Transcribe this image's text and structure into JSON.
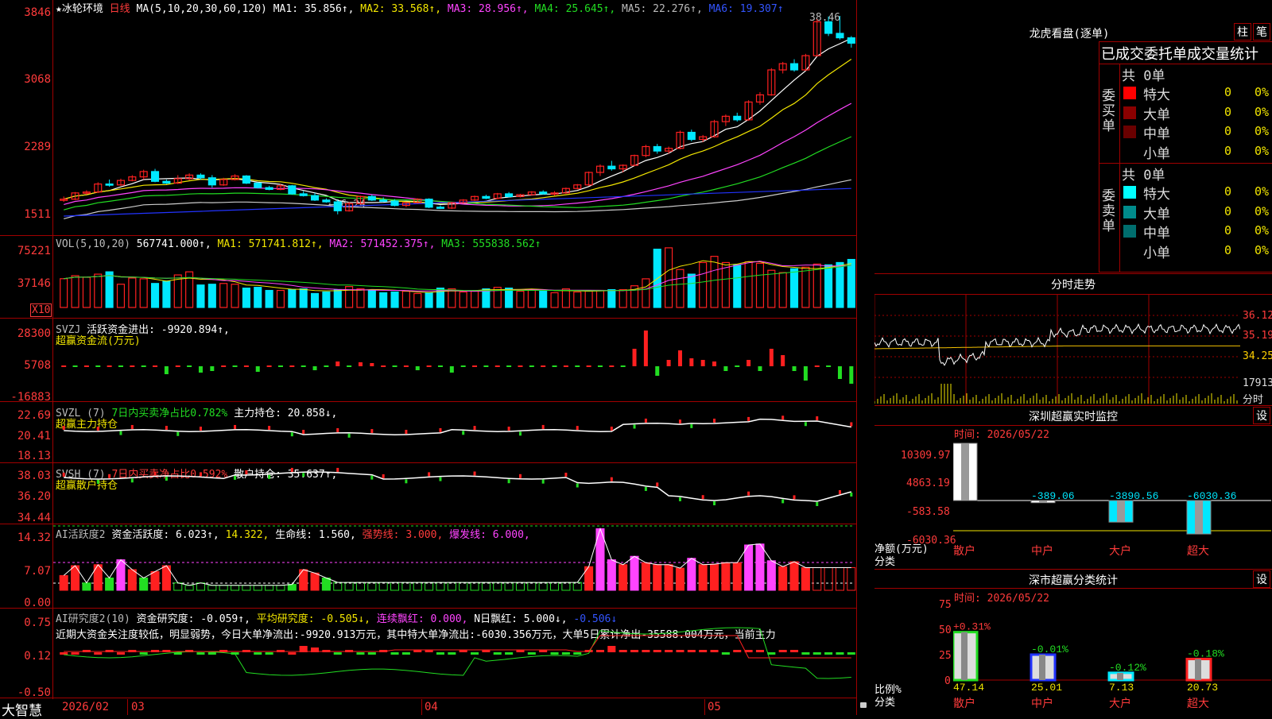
{
  "colors": {
    "grid": "#a00000",
    "up": "#ff2020",
    "down": "#00e8ff",
    "ma1": "#ffffff",
    "ma2": "#f2e600",
    "ma3": "#ff44ff",
    "ma4": "#22dd22",
    "ma5": "#cccccc",
    "ma6": "#2233ff"
  },
  "price_pane": {
    "title_star": "★",
    "stock_name": "冰轮环境",
    "period": "日线",
    "ma_spec": "MA(5,10,20,30,60,120)",
    "ma1": "MA1: 35.856↑,",
    "ma2": "MA2: 33.568↑,",
    "ma3": "MA3: 28.956↑,",
    "ma4": "MA4: 25.645↑,",
    "ma5": "MA5: 22.276↑,",
    "ma6": "MA6: 19.307↑",
    "axis": [
      "3846",
      "3068",
      "2289",
      "1511"
    ],
    "high_mark": "38.46",
    "low_mark": "←16.24"
  },
  "vol_pane": {
    "label": "VOL(5,10,20)",
    "vol": "567741.000↑,",
    "ma1": "MA1: 571741.812↑,",
    "ma2": "MA2: 571452.375↑,",
    "ma3": "MA3: 555838.562↑",
    "axis": [
      "75221",
      "37146"
    ],
    "unit": "X10"
  },
  "svzj_pane": {
    "label": "SVZJ",
    "text": "活跃资金进出: -9920.894↑,",
    "subtitle": "超赢资金流(万元)",
    "axis": [
      "28300",
      "5708",
      "-16883"
    ]
  },
  "svzl_pane": {
    "label": "SVZL (7)",
    "text1": "7日内买卖净占比0.782%",
    "text2": "主力持仓: 20.858↓,",
    "subtitle": "超赢主力持仓",
    "axis": [
      "22.69",
      "20.41",
      "18.13"
    ]
  },
  "svsh_pane": {
    "label": "SVSH (7)",
    "text1": "7日内买卖净占比0.592%",
    "text2": "散户持仓: 35.637↑,",
    "subtitle": "超赢散户持仓",
    "axis": [
      "38.03",
      "36.20",
      "34.44"
    ]
  },
  "ai_active_pane": {
    "label": "AI活跃度2",
    "t1": "资金活跃度: 6.023↑,",
    "t2": "14.322,",
    "t3": "生命线: 1.560,",
    "t4": "强势线: 3.000,",
    "t5": "爆发线: 6.000,",
    "axis": [
      "14.32",
      "7.07",
      "0.00"
    ]
  },
  "ai_research_pane": {
    "label": "AI研究度2(10)",
    "t1": "资金研究度: -0.059↑,",
    "t2": "平均研究度: -0.505↓,",
    "t3": "连续飘红: 0.000,",
    "t4": "N日飘红: 5.000↓,",
    "t5": "-0.506↓",
    "comment": "近期大资金关注度较低，明显弱势，今日大单净流出:-9920.913万元，其中特大单净流出:-6030.356万元，大单5日累计净出-35588.004万元，当前主力",
    "axis": [
      "0.75",
      "0.12",
      "-0.50"
    ]
  },
  "bottom_bar": {
    "brand": "大智慧",
    "dates": [
      "2026/02",
      "03",
      "04",
      "05"
    ]
  },
  "lhb": {
    "title": "龙虎看盘(逐单)",
    "btn1": "柱",
    "btn2": "笔",
    "header": "已成交委托单成交量统计",
    "buy_label": "委买单",
    "sell_label": "委卖单",
    "buy_total": "共 0单",
    "sell_total": "共 0单",
    "buy_rows": [
      {
        "name": "特大",
        "count": "0",
        "pct": "0%",
        "color": "#ff0000"
      },
      {
        "name": "大单",
        "count": "0",
        "pct": "0%",
        "color": "#8b0000"
      },
      {
        "name": "中单",
        "count": "0",
        "pct": "0%",
        "color": "#6a0000"
      },
      {
        "name": "小单",
        "count": "0",
        "pct": "0%",
        "color": "#000000"
      }
    ],
    "sell_rows": [
      {
        "name": "特大",
        "count": "0",
        "pct": "0%",
        "color": "#00ffff"
      },
      {
        "name": "大单",
        "count": "0",
        "pct": "0%",
        "color": "#008b8b"
      },
      {
        "name": "中单",
        "count": "0",
        "pct": "0%",
        "color": "#006e6e"
      },
      {
        "name": "小单",
        "count": "0",
        "pct": "0%",
        "color": "#000000"
      }
    ]
  },
  "intraday": {
    "title": "分时走势",
    "right_axis": [
      "36.12",
      "35.19",
      "34.25",
      "17913"
    ],
    "unit_label": "分时"
  },
  "sz_monitor": {
    "title": "深圳超赢实时监控",
    "btn": "设",
    "time": "时间: 2026/05/22",
    "axis": [
      "10309.97",
      "4863.19",
      "-583.58",
      "-6030.36"
    ],
    "ylabel1": "净额(万元)",
    "ylabel2": "分类",
    "bars": [
      {
        "cat": "散户",
        "value": 10309.97,
        "label": "10309.97",
        "color": "#ffffff"
      },
      {
        "cat": "中户",
        "value": -389.06,
        "label": "-389.06",
        "color": "#ffffff"
      },
      {
        "cat": "大户",
        "value": -3890.56,
        "label": "-3890.56",
        "color": "#00e8ff"
      },
      {
        "cat": "超大",
        "value": -6030.36,
        "label": "-6030.36",
        "color": "#00e8ff"
      }
    ]
  },
  "sz_class": {
    "title": "深市超赢分类统计",
    "btn": "设",
    "time": "时间: 2026/05/22",
    "axis": [
      "75",
      "50",
      "25",
      "0"
    ],
    "ylabel1": "比例%",
    "ylabel2": "分类",
    "bars": [
      {
        "cat": "散户",
        "value": 47.14,
        "label": "47.14",
        "delta": "+0.31%",
        "color": "#ffffff",
        "edge": "#22dd22"
      },
      {
        "cat": "中户",
        "value": 25.01,
        "label": "25.01",
        "delta": "-0.01%",
        "color": "#ffffff",
        "edge": "#2233ff"
      },
      {
        "cat": "大户",
        "value": 7.13,
        "label": "7.13",
        "delta": "-0.12%",
        "color": "#ffffff",
        "edge": "#00e8ff"
      },
      {
        "cat": "超大",
        "value": 20.73,
        "label": "20.73",
        "delta": "-0.18%",
        "color": "#ffffff",
        "edge": "#ff2020"
      }
    ]
  },
  "chart_data": {
    "type": "candlestick",
    "candles_ohlc_approx": [
      [
        17.8,
        18.2,
        17.6,
        17.9
      ],
      [
        17.9,
        18.7,
        17.8,
        18.6
      ],
      [
        18.6,
        18.9,
        18.4,
        18.7
      ],
      [
        18.7,
        19.8,
        18.6,
        19.6
      ],
      [
        19.6,
        20.1,
        19.3,
        19.5
      ],
      [
        19.5,
        20.2,
        19.4,
        20.0
      ],
      [
        20.0,
        20.6,
        19.9,
        20.4
      ],
      [
        20.4,
        21.2,
        20.1,
        21.0
      ],
      [
        21.0,
        21.3,
        19.8,
        19.9
      ],
      [
        19.9,
        20.1,
        19.6,
        19.7
      ],
      [
        19.7,
        20.6,
        19.6,
        20.2
      ],
      [
        20.2,
        20.8,
        20.0,
        20.6
      ],
      [
        20.6,
        20.8,
        20.1,
        20.3
      ],
      [
        20.3,
        20.6,
        19.2,
        19.5
      ],
      [
        19.5,
        20.3,
        19.4,
        20.1
      ],
      [
        20.1,
        20.7,
        20.0,
        20.5
      ],
      [
        20.5,
        20.6,
        19.6,
        19.7
      ],
      [
        19.7,
        19.8,
        19.1,
        19.2
      ],
      [
        19.2,
        19.4,
        18.9,
        19.0
      ],
      [
        19.0,
        19.6,
        18.9,
        19.4
      ],
      [
        19.4,
        19.5,
        18.4,
        18.5
      ],
      [
        18.5,
        18.8,
        18.2,
        18.3
      ],
      [
        18.3,
        18.6,
        17.7,
        17.8
      ],
      [
        17.8,
        18.0,
        17.5,
        17.6
      ],
      [
        17.6,
        17.8,
        16.2,
        16.6
      ],
      [
        16.6,
        17.6,
        16.5,
        17.4
      ],
      [
        17.4,
        18.3,
        17.3,
        18.2
      ],
      [
        18.2,
        18.4,
        17.7,
        17.8
      ],
      [
        17.8,
        18.1,
        17.6,
        17.7
      ],
      [
        17.7,
        17.9,
        17.1,
        17.2
      ],
      [
        17.2,
        17.6,
        17.0,
        17.5
      ],
      [
        17.5,
        18.0,
        17.4,
        17.9
      ],
      [
        17.9,
        18.0,
        16.9,
        17.0
      ],
      [
        17.0,
        17.2,
        16.8,
        16.9
      ],
      [
        16.9,
        17.6,
        16.8,
        17.5
      ],
      [
        17.5,
        17.9,
        17.4,
        17.8
      ],
      [
        17.8,
        18.3,
        17.7,
        18.2
      ],
      [
        18.2,
        18.4,
        17.9,
        18.0
      ],
      [
        18.0,
        18.6,
        17.9,
        18.5
      ],
      [
        18.5,
        18.7,
        18.1,
        18.2
      ],
      [
        18.2,
        18.5,
        18.1,
        18.4
      ],
      [
        18.4,
        18.8,
        18.3,
        18.7
      ],
      [
        18.7,
        18.9,
        18.4,
        18.5
      ],
      [
        18.5,
        18.8,
        18.3,
        18.6
      ],
      [
        18.6,
        19.2,
        18.5,
        19.1
      ],
      [
        19.1,
        19.6,
        19.0,
        19.5
      ],
      [
        19.5,
        21.0,
        19.4,
        20.9
      ],
      [
        20.9,
        21.8,
        20.5,
        21.6
      ],
      [
        21.6,
        22.2,
        21.1,
        21.3
      ],
      [
        21.3,
        21.8,
        20.9,
        21.7
      ],
      [
        21.7,
        22.9,
        21.6,
        22.8
      ],
      [
        22.8,
        24.0,
        22.6,
        23.8
      ],
      [
        23.8,
        24.1,
        23.0,
        23.3
      ],
      [
        23.3,
        23.8,
        23.0,
        23.6
      ],
      [
        23.6,
        25.6,
        23.5,
        25.4
      ],
      [
        25.4,
        25.7,
        24.4,
        24.6
      ],
      [
        24.6,
        25.1,
        24.3,
        24.9
      ],
      [
        24.9,
        26.8,
        24.8,
        26.6
      ],
      [
        26.6,
        27.4,
        26.1,
        27.2
      ],
      [
        27.2,
        27.6,
        26.6,
        26.8
      ],
      [
        26.8,
        29.0,
        26.7,
        28.8
      ],
      [
        28.8,
        29.9,
        28.5,
        29.6
      ],
      [
        29.6,
        32.6,
        29.5,
        32.4
      ],
      [
        32.4,
        33.3,
        32.0,
        33.1
      ],
      [
        33.1,
        33.6,
        32.2,
        32.4
      ],
      [
        32.4,
        34.2,
        32.3,
        34.0
      ],
      [
        34.0,
        38.1,
        33.9,
        37.8
      ],
      [
        37.8,
        38.4,
        36.2,
        36.5
      ],
      [
        36.5,
        38.46,
        35.8,
        36.0
      ],
      [
        36.0,
        36.2,
        34.9,
        35.4
      ]
    ],
    "volume_x10": [
      37146,
      41000,
      39000,
      43000,
      46000,
      30000,
      38000,
      37000,
      31000,
      34000,
      42000,
      46000,
      29000,
      30000,
      31000,
      30000,
      25000,
      26000,
      22000,
      22000,
      23000,
      24000,
      18000,
      20000,
      23000,
      27000,
      24000,
      22000,
      19000,
      20000,
      21000,
      18000,
      19000,
      25000,
      24000,
      20000,
      21000,
      24000,
      26000,
      25000,
      21000,
      23000,
      21000,
      19000,
      24000,
      20000,
      21000,
      22000,
      23000,
      23000,
      28000,
      37000,
      75221,
      77000,
      49000,
      43000,
      58000,
      66000,
      58000,
      55000,
      59000,
      57000,
      48000,
      45000,
      50000,
      52000,
      56000,
      55000,
      58000,
      62000
    ]
  }
}
